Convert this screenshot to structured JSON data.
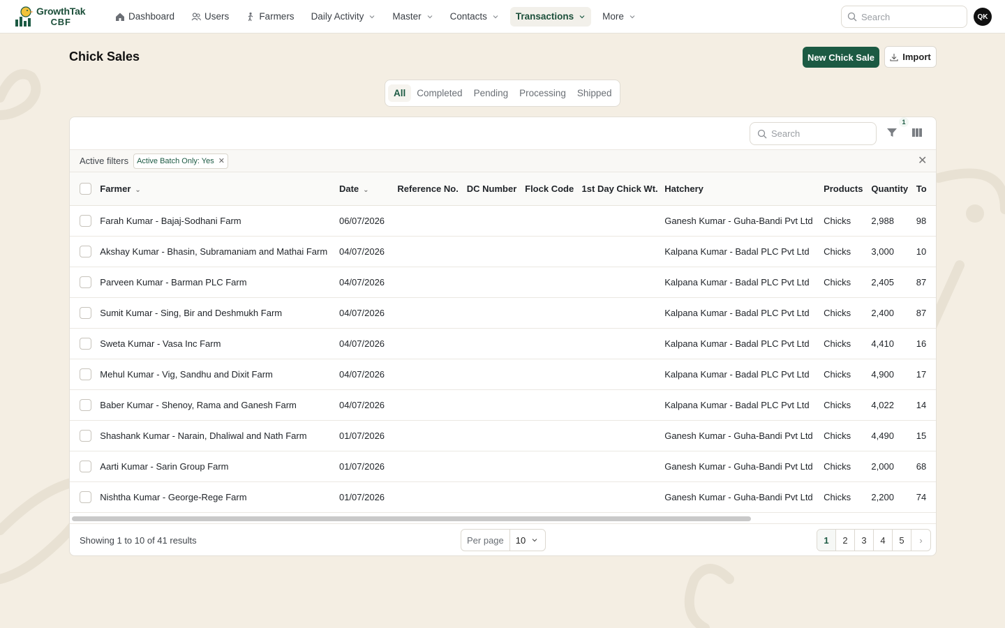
{
  "brand": {
    "name": "GrowthTak",
    "sub": "CBF"
  },
  "nav": [
    {
      "label": "Dashboard",
      "icon": "home-icon",
      "dropdown": false,
      "active": false
    },
    {
      "label": "Users",
      "icon": "users-icon",
      "dropdown": false,
      "active": false
    },
    {
      "label": "Farmers",
      "icon": "farmer-icon",
      "dropdown": false,
      "active": false
    },
    {
      "label": "Daily Activity",
      "icon": "",
      "dropdown": true,
      "active": false
    },
    {
      "label": "Master",
      "icon": "",
      "dropdown": true,
      "active": false
    },
    {
      "label": "Contacts",
      "icon": "",
      "dropdown": true,
      "active": false
    },
    {
      "label": "Transactions",
      "icon": "",
      "dropdown": true,
      "active": true
    },
    {
      "label": "More",
      "icon": "",
      "dropdown": true,
      "active": false
    }
  ],
  "top_search": {
    "placeholder": "Search"
  },
  "user": {
    "initials": "QK"
  },
  "page": {
    "title": "Chick Sales",
    "new_button": "New Chick Sale",
    "import_button": "Import"
  },
  "tabs": [
    {
      "label": "All",
      "active": true
    },
    {
      "label": "Completed",
      "active": false
    },
    {
      "label": "Pending",
      "active": false
    },
    {
      "label": "Processing",
      "active": false
    },
    {
      "label": "Shipped",
      "active": false
    }
  ],
  "toolbar": {
    "search_placeholder": "Search",
    "filter_count": "1"
  },
  "active_filters": {
    "label": "Active filters",
    "chips": [
      "Active Batch Only: Yes"
    ]
  },
  "table": {
    "columns": [
      "Farmer",
      "Date",
      "Reference No.",
      "DC Number",
      "Flock Code",
      "1st Day Chick Wt.",
      "Hatchery",
      "Products",
      "Quantity",
      "To"
    ],
    "rows": [
      {
        "farmer": "Farah Kumar - Bajaj-Sodhani Farm",
        "date": "06/07/2026",
        "ref": "",
        "dc": "",
        "flock": "",
        "wt": "",
        "hatchery": "Ganesh Kumar - Guha-Bandi Pvt Ltd",
        "products": "Chicks",
        "quantity": "2,988",
        "total": "98"
      },
      {
        "farmer": "Akshay Kumar - Bhasin, Subramaniam and Mathai Farm",
        "date": "04/07/2026",
        "ref": "",
        "dc": "",
        "flock": "",
        "wt": "",
        "hatchery": "Kalpana Kumar - Badal PLC Pvt Ltd",
        "products": "Chicks",
        "quantity": "3,000",
        "total": "10"
      },
      {
        "farmer": "Parveen Kumar - Barman PLC Farm",
        "date": "04/07/2026",
        "ref": "",
        "dc": "",
        "flock": "",
        "wt": "",
        "hatchery": "Kalpana Kumar - Badal PLC Pvt Ltd",
        "products": "Chicks",
        "quantity": "2,405",
        "total": "87"
      },
      {
        "farmer": "Sumit Kumar - Sing, Bir and Deshmukh Farm",
        "date": "04/07/2026",
        "ref": "",
        "dc": "",
        "flock": "",
        "wt": "",
        "hatchery": "Kalpana Kumar - Badal PLC Pvt Ltd",
        "products": "Chicks",
        "quantity": "2,400",
        "total": "87"
      },
      {
        "farmer": "Sweta Kumar - Vasa Inc Farm",
        "date": "04/07/2026",
        "ref": "",
        "dc": "",
        "flock": "",
        "wt": "",
        "hatchery": "Kalpana Kumar - Badal PLC Pvt Ltd",
        "products": "Chicks",
        "quantity": "4,410",
        "total": "16"
      },
      {
        "farmer": "Mehul Kumar - Vig, Sandhu and Dixit Farm",
        "date": "04/07/2026",
        "ref": "",
        "dc": "",
        "flock": "",
        "wt": "",
        "hatchery": "Kalpana Kumar - Badal PLC Pvt Ltd",
        "products": "Chicks",
        "quantity": "4,900",
        "total": "17"
      },
      {
        "farmer": "Baber Kumar - Shenoy, Rama and Ganesh Farm",
        "date": "04/07/2026",
        "ref": "",
        "dc": "",
        "flock": "",
        "wt": "",
        "hatchery": "Kalpana Kumar - Badal PLC Pvt Ltd",
        "products": "Chicks",
        "quantity": "4,022",
        "total": "14"
      },
      {
        "farmer": "Shashank Kumar - Narain, Dhaliwal and Nath Farm",
        "date": "01/07/2026",
        "ref": "",
        "dc": "",
        "flock": "",
        "wt": "",
        "hatchery": "Ganesh Kumar - Guha-Bandi Pvt Ltd",
        "products": "Chicks",
        "quantity": "4,490",
        "total": "15"
      },
      {
        "farmer": "Aarti Kumar - Sarin Group Farm",
        "date": "01/07/2026",
        "ref": "",
        "dc": "",
        "flock": "",
        "wt": "",
        "hatchery": "Ganesh Kumar - Guha-Bandi Pvt Ltd",
        "products": "Chicks",
        "quantity": "2,000",
        "total": "68"
      },
      {
        "farmer": "Nishtha Kumar - George-Rege Farm",
        "date": "01/07/2026",
        "ref": "",
        "dc": "",
        "flock": "",
        "wt": "",
        "hatchery": "Ganesh Kumar - Guha-Bandi Pvt Ltd",
        "products": "Chicks",
        "quantity": "2,200",
        "total": "74"
      }
    ]
  },
  "footer": {
    "showing": "Showing 1 to 10 of 41 results",
    "per_page_label": "Per page",
    "per_page_value": "10",
    "pages": [
      "1",
      "2",
      "3",
      "4",
      "5"
    ],
    "current_page": "1",
    "next": "›"
  },
  "colors": {
    "brand": "#1c5a43",
    "background": "#f4eee3"
  }
}
